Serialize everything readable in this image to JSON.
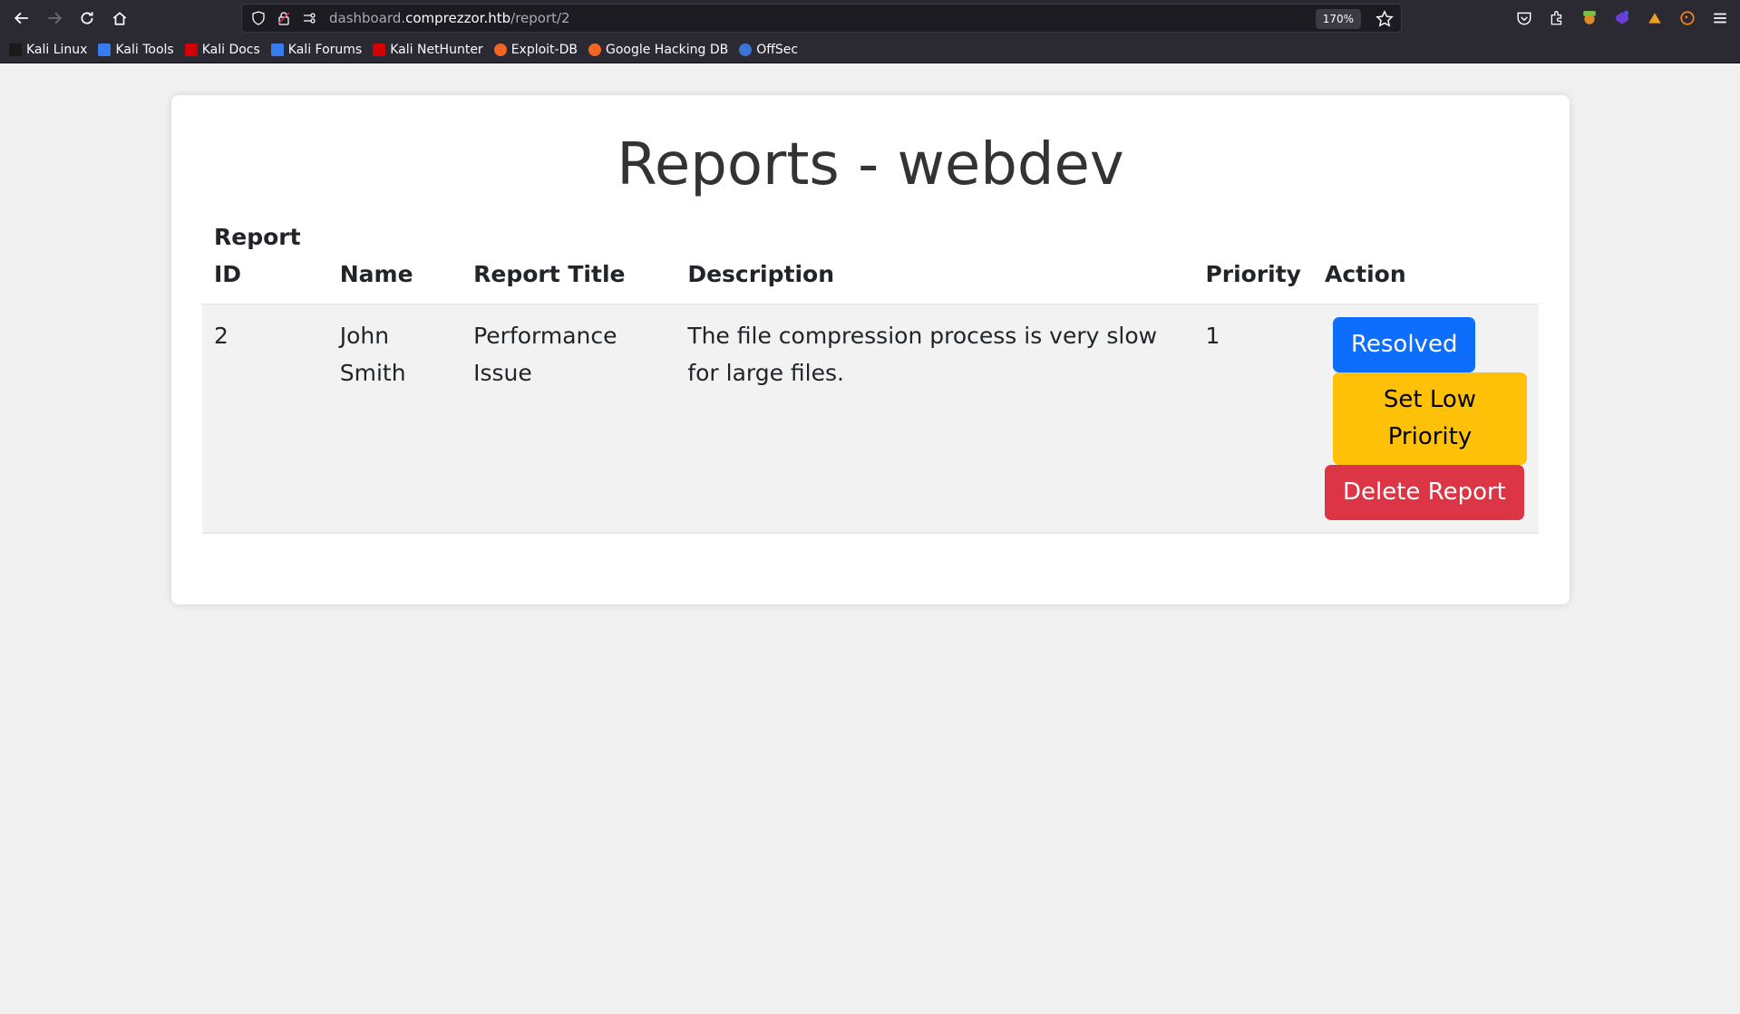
{
  "browser": {
    "url_prefix": "dashboard.",
    "url_host": "comprezzor.htb",
    "url_path": "/report/2",
    "zoom": "170%"
  },
  "bookmarks": [
    {
      "label": "Kali Linux",
      "color": "#1a1a1a"
    },
    {
      "label": "Kali Tools",
      "color": "#367bf0"
    },
    {
      "label": "Kali Docs",
      "color": "#d40000"
    },
    {
      "label": "Kali Forums",
      "color": "#367bf0"
    },
    {
      "label": "Kali NetHunter",
      "color": "#d40000"
    },
    {
      "label": "Exploit-DB",
      "color": "#f26522"
    },
    {
      "label": "Google Hacking DB",
      "color": "#f26522"
    },
    {
      "label": "OffSec",
      "color": "#3a74d6"
    }
  ],
  "page": {
    "title": "Reports - webdev"
  },
  "table": {
    "headers": {
      "id_line1": "Report",
      "id_line2": "ID",
      "name": "Name",
      "title": "Report Title",
      "description": "Description",
      "priority": "Priority",
      "action": "Action"
    },
    "rows": [
      {
        "id": "2",
        "name": "John Smith",
        "title": "Performance Issue",
        "description": "The file compression process is very slow for large files.",
        "priority": "1"
      }
    ]
  },
  "actions": {
    "resolved": "Resolved",
    "low_priority": "Set Low Priority",
    "delete": "Delete Report"
  },
  "colors": {
    "primary": "#0d6efd",
    "warning": "#ffc107",
    "danger": "#dc3545"
  }
}
